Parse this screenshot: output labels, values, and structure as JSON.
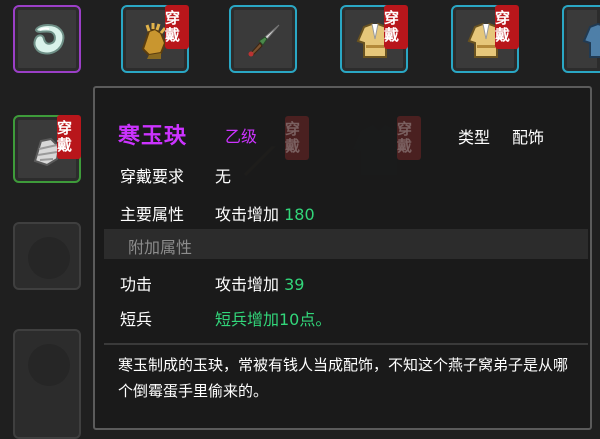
{
  "badges": {
    "wear": "穿戴"
  },
  "slots": [
    {
      "icon": "jade-ring-icon",
      "border": "purple",
      "badge": false
    },
    {
      "icon": "gauntlet-icon",
      "border": "cyan",
      "badge": true
    },
    {
      "icon": "dagger-icon",
      "border": "cyan",
      "badge": false
    },
    {
      "icon": "robe-icon",
      "border": "cyan",
      "badge": true
    },
    {
      "icon": "robe-icon",
      "border": "cyan",
      "badge": true
    },
    {
      "icon": "robe-partial-icon",
      "border": "cyan",
      "badge": false
    },
    {
      "icon": "bandage-gauntlet-icon",
      "border": "green",
      "badge": true
    },
    {
      "icon": "empty",
      "border": "gray",
      "badge": false
    },
    {
      "icon": "empty",
      "border": "gray",
      "badge": false
    }
  ],
  "tooltip": {
    "name": "寒玉玦",
    "grade": "乙级",
    "type_label": "类型",
    "type_value": "配饰",
    "requirement": {
      "label": "穿戴要求",
      "value": "无"
    },
    "main_attr": {
      "label": "主要属性",
      "text": "攻击增加",
      "value": "180"
    },
    "extra_section": "附加属性",
    "attack": {
      "label": "功击",
      "text": "攻击增加",
      "value": "39"
    },
    "short_weapon": {
      "label": "短兵",
      "value": "短兵增加10点。"
    },
    "description": "寒玉制成的玉玦，常被有钱人当成配饰，不知这个燕子窝弟子是从哪个倒霉蛋手里偷来的。"
  },
  "colors": {
    "legendary": "#cc33ff",
    "stat_number": "#32d67a",
    "slot_cyan": "#2aa7c4",
    "slot_purple": "#9b3fc7",
    "slot_green": "#3e9b3a",
    "badge_red": "#b8161b"
  }
}
